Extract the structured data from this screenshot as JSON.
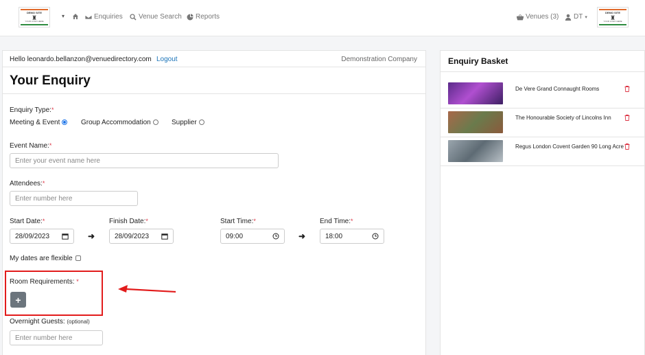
{
  "header": {
    "logo_top": "DEMO SITE",
    "logo_bottom": "YOUR LOGO HERE",
    "nav": [
      {
        "label": "Enquiries",
        "icon": "envelope-icon"
      },
      {
        "label": "Venue Search",
        "icon": "search-icon"
      },
      {
        "label": "Reports",
        "icon": "pie-chart-icon"
      }
    ],
    "venues_label": "Venues (3)",
    "user_initials": "DT"
  },
  "session": {
    "greeting": "Hello leonardo.bellanzon@venuedirectory.com",
    "logout": "Logout",
    "company": "Demonstration Company"
  },
  "form": {
    "title": "Your Enquiry",
    "enquiry_type_label": "Enquiry Type:",
    "types": [
      {
        "label": "Meeting & Event",
        "selected": true
      },
      {
        "label": "Group Accommodation",
        "selected": false
      },
      {
        "label": "Supplier",
        "selected": false
      }
    ],
    "event_name_label": "Event Name:",
    "event_name_placeholder": "Enter your event name here",
    "attendees_label": "Attendees:",
    "attendees_placeholder": "Enter number here",
    "start_date_label": "Start Date:",
    "start_date_value": "28/09/2023",
    "finish_date_label": "Finish Date:",
    "finish_date_value": "28/09/2023",
    "start_time_label": "Start Time:",
    "start_time_value": "09:00",
    "end_time_label": "End Time:",
    "end_time_value": "18:00",
    "flexible_label": "My dates are flexible",
    "room_req_label": "Room Requirements:",
    "overnight_label": "Overnight Guests:",
    "optional": "(optional)",
    "overnight_placeholder": "Enter number here",
    "required_mark": "*",
    "add_symbol": "+"
  },
  "basket": {
    "title": "Enquiry Basket",
    "items": [
      {
        "name": "De Vere Grand Connaught Rooms",
        "thumb_color": "#8a3fb3"
      },
      {
        "name": "The Honourable Society of Lincolns Inn",
        "thumb_color": "#8b5a3c"
      },
      {
        "name": "Regus London Covent Garden 90 Long Acre",
        "thumb_color": "#7d8a93"
      }
    ]
  },
  "colors": {
    "accent": "#1a73b8",
    "required": "#dc3545",
    "highlight": "#e21b1b"
  }
}
